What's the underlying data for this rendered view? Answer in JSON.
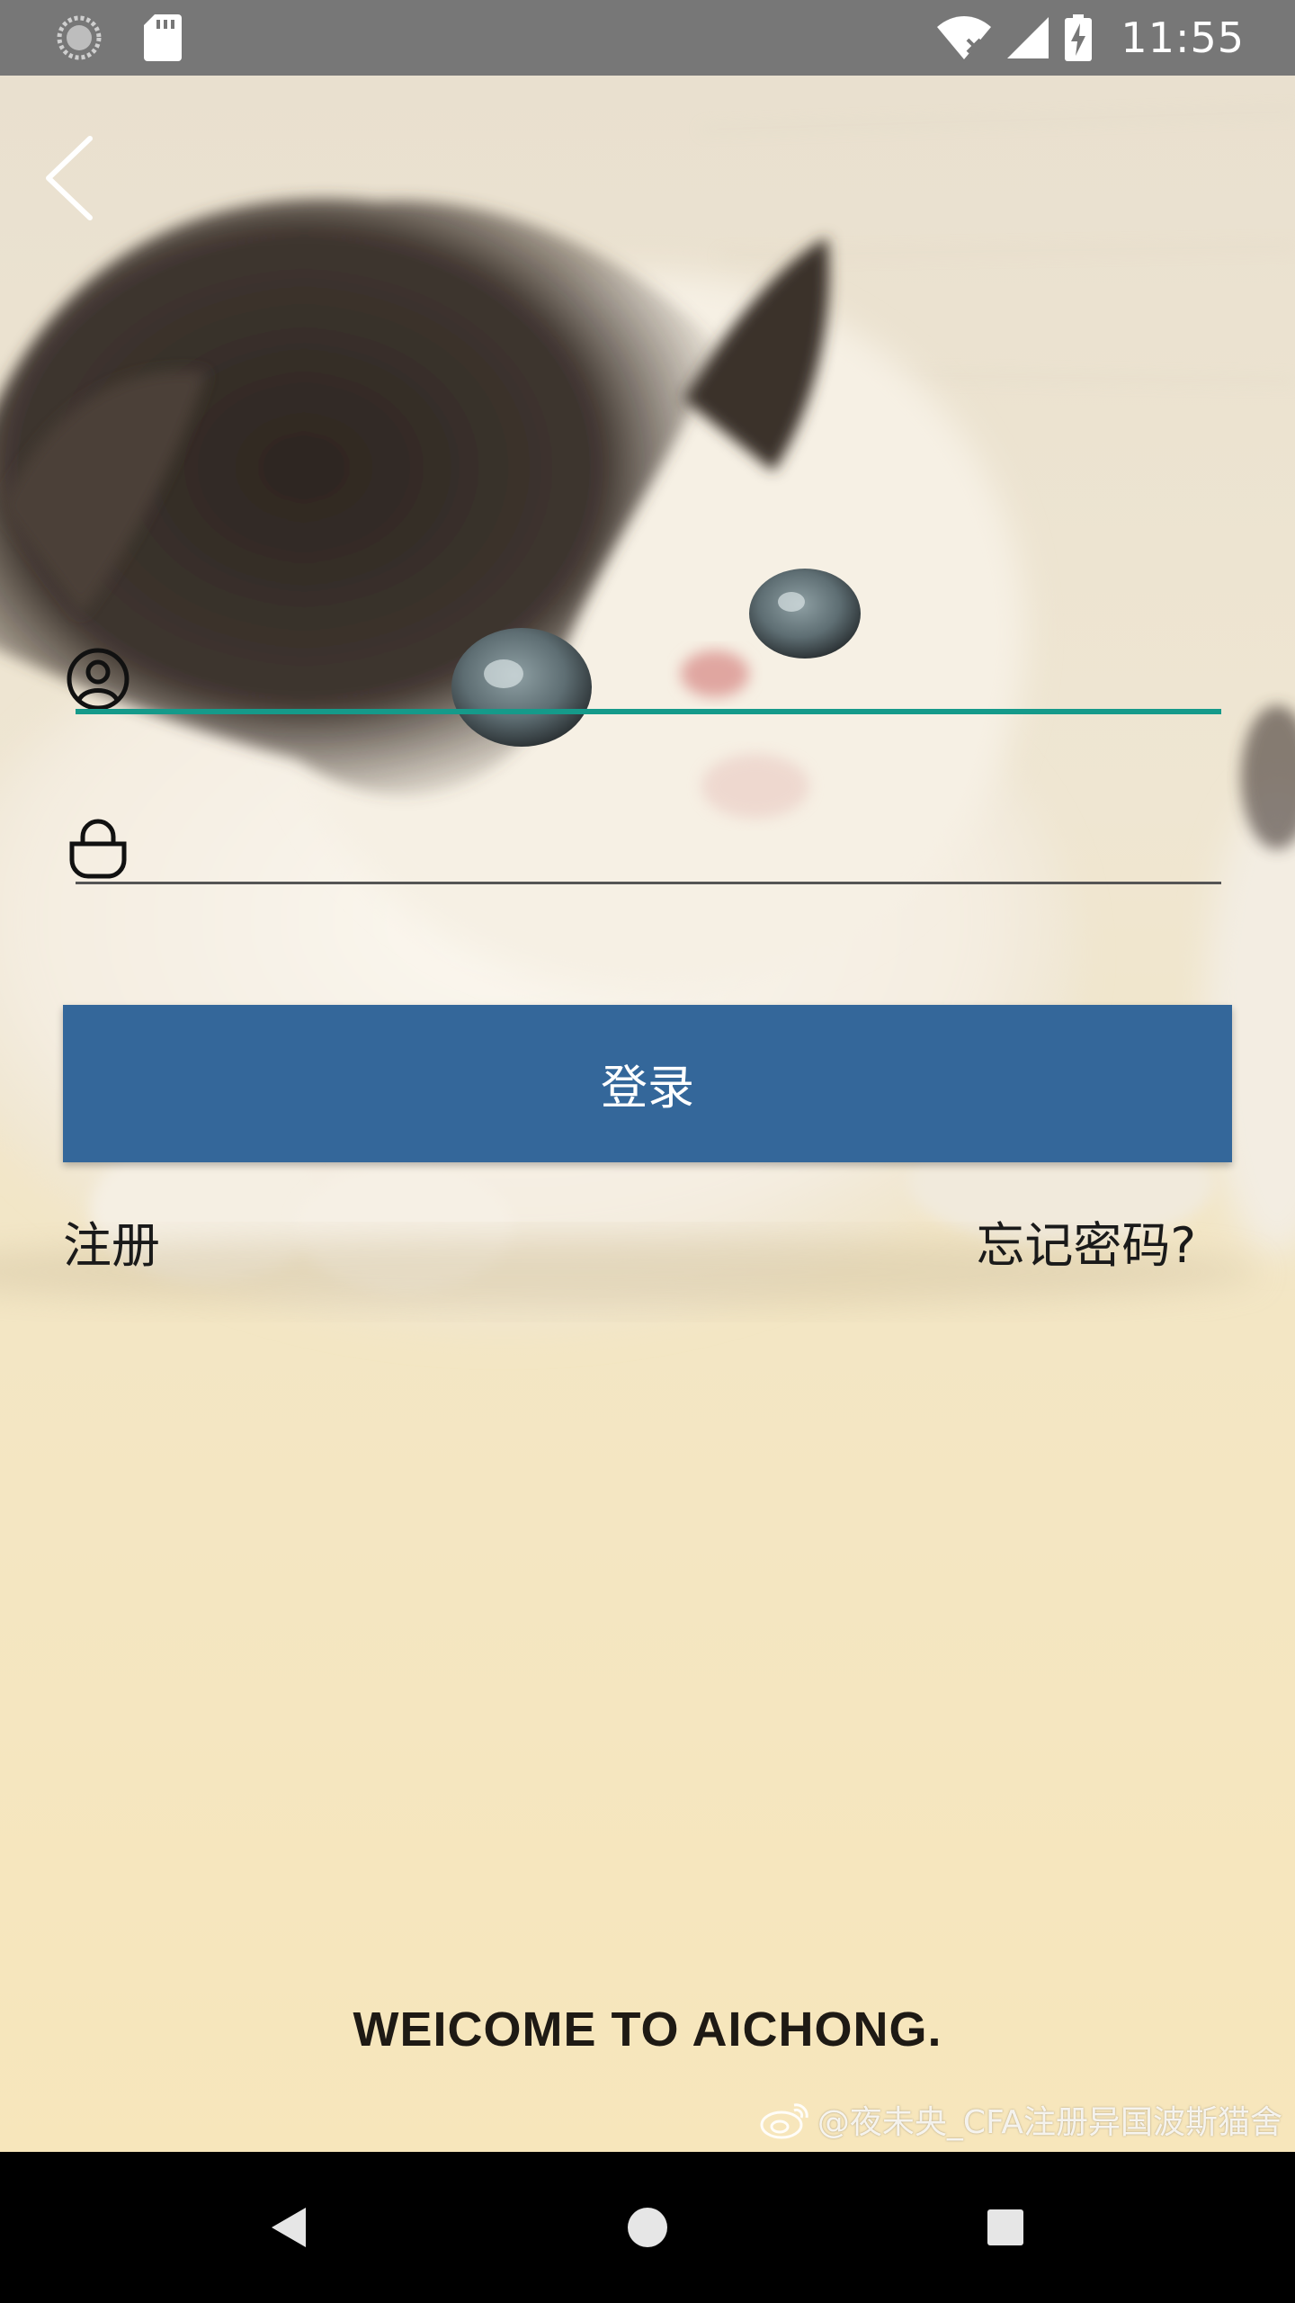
{
  "status_bar": {
    "time": "11:55"
  },
  "login_form": {
    "username_placeholder": "",
    "password_placeholder": "",
    "login_button_label": "登录",
    "register_link_label": "注册",
    "forgot_password_link_label": "忘记密码?"
  },
  "welcome": {
    "text": "WEICOME TO AICHONG."
  },
  "watermark": {
    "text": "@夜未央_CFA注册异国波斯猫舍"
  },
  "colors": {
    "status_bar_bg": "#777777",
    "login_button_bg": "#34679a",
    "username_underline_active": "#159a8a",
    "password_underline": "#555555",
    "nav_bar_bg": "#000000"
  },
  "icons": {
    "status_left": [
      "sync-icon",
      "sd-card-icon"
    ],
    "status_right": [
      "wifi-icon",
      "cellular-signal-icon",
      "battery-charging-icon"
    ],
    "back": "back-arrow-icon",
    "username_field": "user-icon",
    "password_field": "lock-icon",
    "watermark": "weibo-icon",
    "nav": [
      "nav-back-icon",
      "nav-home-icon",
      "nav-recents-icon"
    ]
  }
}
